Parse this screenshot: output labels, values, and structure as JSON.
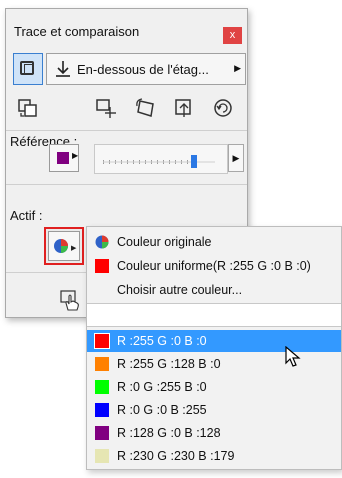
{
  "palette": {
    "title": "Trace et comparaison",
    "close_label": "x",
    "placement_label": "En-dessous de l'étag...",
    "reference_label": "Référence :",
    "active_label": "Actif :"
  },
  "colors": {
    "reference_chip": "#800080",
    "slider_accent": "#2b78e4",
    "selection": "#3399ff",
    "highlight_border": "#e02020"
  },
  "menu": {
    "options": [
      {
        "label": "Couleur originale",
        "icon": "color-wheel-icon"
      },
      {
        "label": "Couleur uniforme(R :255 G :0 B :0)",
        "swatch": "#ff0000"
      },
      {
        "label": "Choisir autre couleur...",
        "swatch": ""
      }
    ],
    "recent_colors": [
      {
        "label": "R :255 G :0 B :0",
        "swatch": "#ff0000"
      },
      {
        "label": "R :255 G :128 B :0",
        "swatch": "#ff8000"
      },
      {
        "label": "R :0 G :255 B :0",
        "swatch": "#00ff00"
      },
      {
        "label": "R :0 G :0 B :255",
        "swatch": "#0000ff"
      },
      {
        "label": "R :128 G :0 B :128",
        "swatch": "#800080"
      },
      {
        "label": "R :230 G :230 B :179",
        "swatch": "#e6e6b3"
      }
    ]
  }
}
